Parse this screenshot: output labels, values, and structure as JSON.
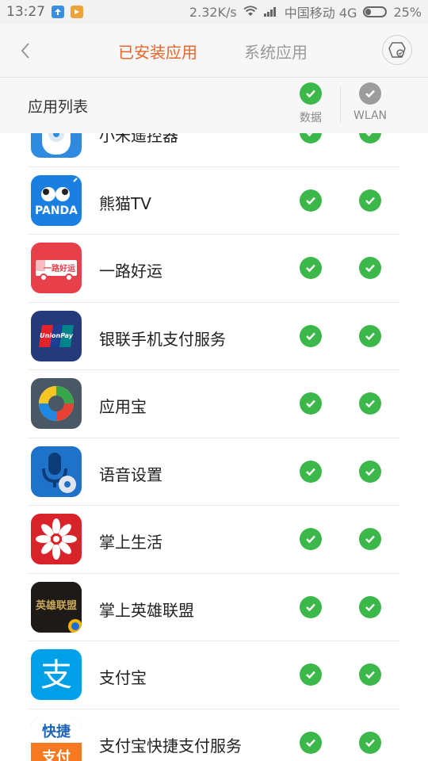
{
  "status_bar": {
    "time": "13:27",
    "net_speed": "2.32K/s",
    "carrier": "中国移动 4G",
    "battery": "25%",
    "battery_level": 0.25
  },
  "header": {
    "tab_installed": "已安装应用",
    "tab_system": "系统应用",
    "accent_color": "#e8662c"
  },
  "list_header": {
    "title": "应用列表",
    "col_data": "数据",
    "col_wlan": "WLAN"
  },
  "apps": [
    {
      "name": "小米遥控器",
      "icon": "mi-remote-icon",
      "data": true,
      "wlan": true
    },
    {
      "name": "熊猫TV",
      "icon": "panda-tv-icon",
      "icon_text": "PANDA",
      "data": true,
      "wlan": true
    },
    {
      "name": "一路好运",
      "icon": "truck-icon",
      "icon_text": "一路好运",
      "data": true,
      "wlan": true
    },
    {
      "name": "银联手机支付服务",
      "icon": "unionpay-icon",
      "icon_text": "UnionPay",
      "data": true,
      "wlan": true
    },
    {
      "name": "应用宝",
      "icon": "yingyongbao-icon",
      "data": true,
      "wlan": true
    },
    {
      "name": "语音设置",
      "icon": "microphone-gear-icon",
      "data": true,
      "wlan": true
    },
    {
      "name": "掌上生活",
      "icon": "flower-icon",
      "data": true,
      "wlan": true
    },
    {
      "name": "掌上英雄联盟",
      "icon": "lol-icon",
      "icon_text": "英雄联盟",
      "data": true,
      "wlan": true
    },
    {
      "name": "支付宝",
      "icon": "alipay-icon",
      "icon_text": "支",
      "data": true,
      "wlan": true
    },
    {
      "name": "支付宝快捷支付服务",
      "icon": "alipay-quickpay-icon",
      "icon_text": "快捷支付",
      "data": true,
      "wlan": true
    }
  ]
}
